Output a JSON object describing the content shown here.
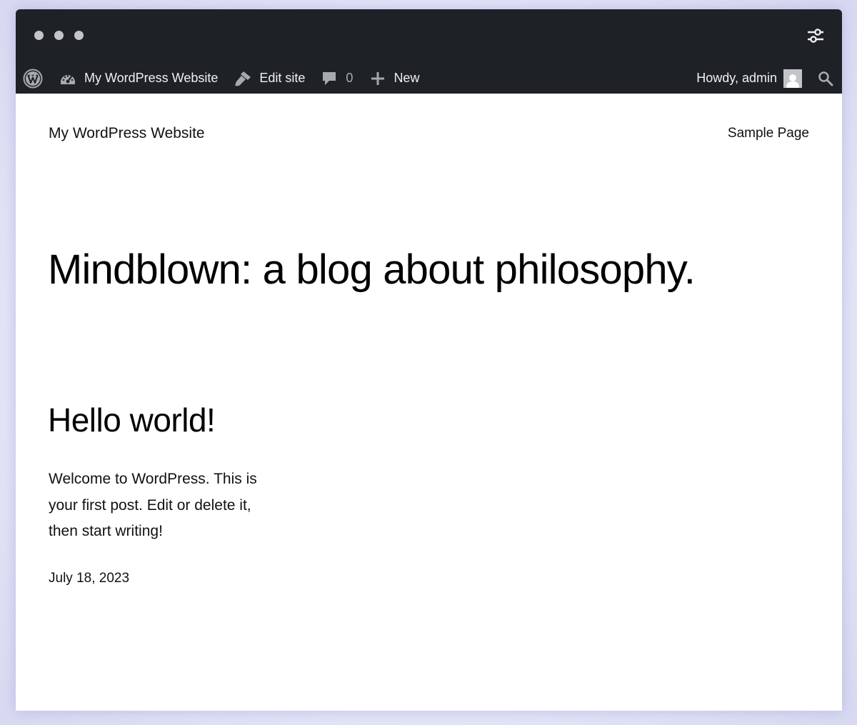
{
  "window": {
    "controls": [
      "close",
      "minimize",
      "maximize"
    ],
    "settings_icon": "sliders-icon"
  },
  "admin_bar": {
    "wp_logo_icon": "wordpress-logo-icon",
    "site_name": "My WordPress Website",
    "site_icon": "dashboard-gauge-icon",
    "edit_site": "Edit site",
    "edit_icon": "brush-icon",
    "comments_count": "0",
    "comments_icon": "comment-bubble-icon",
    "new_label": "New",
    "new_icon": "plus-icon",
    "howdy": "Howdy, admin",
    "avatar_icon": "user-avatar-icon",
    "search_icon": "search-icon"
  },
  "site": {
    "title": "My WordPress Website",
    "nav": [
      "Sample Page"
    ],
    "tagline": "Mindblown: a blog about philosophy."
  },
  "post": {
    "title": "Hello world!",
    "excerpt": "Welcome to WordPress. This is your first post. Edit or delete it, then start writing!",
    "date": "July 18, 2023"
  },
  "colors": {
    "admin_bar_bg": "#1e2227",
    "admin_bar_text": "#f0f0f1",
    "page_bg": "#ffffff",
    "text": "#000000"
  }
}
